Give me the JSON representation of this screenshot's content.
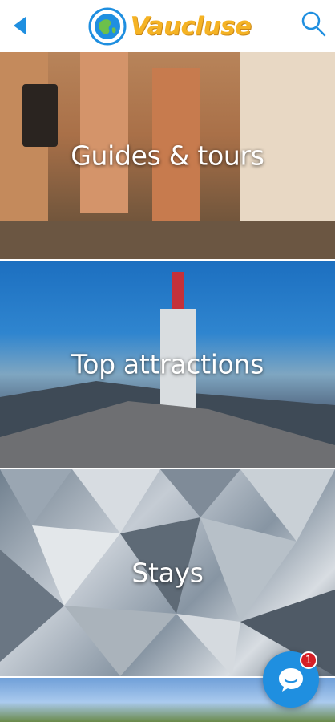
{
  "header": {
    "logo_text": "Vaucluse",
    "back_icon": "back-arrow-icon",
    "search_icon": "search-icon"
  },
  "sections": [
    {
      "label": "Guides & tours"
    },
    {
      "label": "Top attractions"
    },
    {
      "label": "Stays"
    }
  ],
  "chat": {
    "badge_count": "1",
    "icon": "chat-bubble-icon"
  },
  "colors": {
    "brand_blue": "#1f8fe0",
    "logo_yellow": "#f5b324",
    "badge_red": "#d61f26"
  }
}
